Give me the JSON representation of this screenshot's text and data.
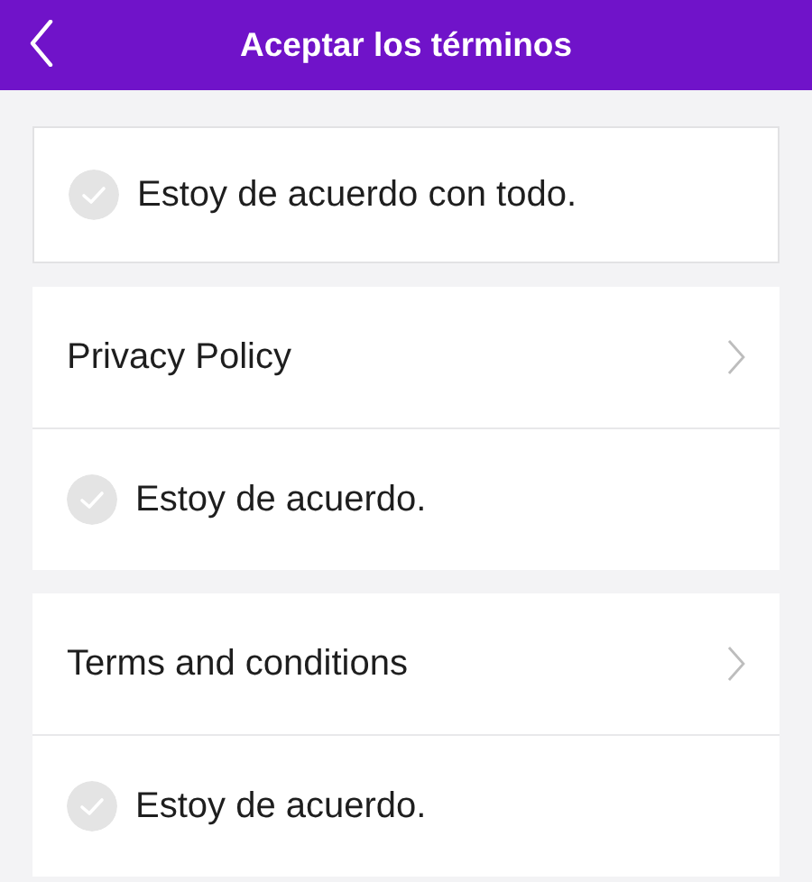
{
  "header": {
    "title": "Aceptar los términos"
  },
  "agree_all": {
    "label": "Estoy de acuerdo con todo.",
    "checked": false
  },
  "documents": [
    {
      "title": "Privacy Policy",
      "agree": {
        "label": "Estoy de acuerdo.",
        "checked": false
      }
    },
    {
      "title": "Terms and conditions",
      "agree": {
        "label": "Estoy de acuerdo.",
        "checked": false
      }
    }
  ]
}
